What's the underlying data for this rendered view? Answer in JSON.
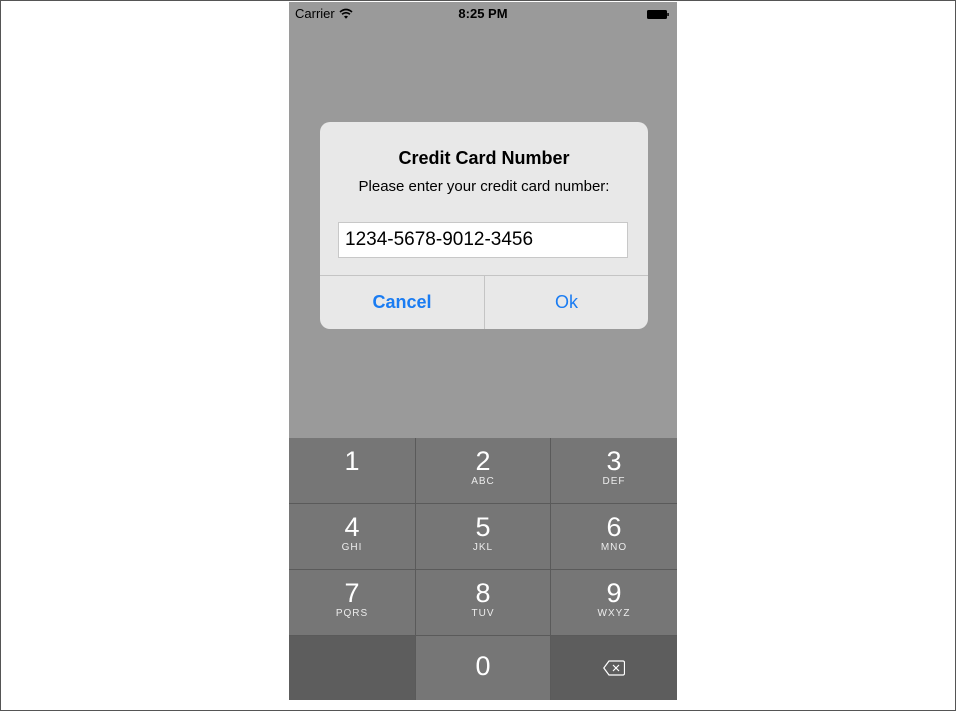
{
  "status_bar": {
    "carrier": "Carrier",
    "time": "8:25 PM",
    "wifi_icon": "wifi-icon",
    "battery_icon": "battery-icon"
  },
  "alert": {
    "title": "Credit Card Number",
    "message": "Please enter your credit card number:",
    "input_value": "1234-5678-9012-3456",
    "cancel_label": "Cancel",
    "ok_label": "Ok",
    "button_color": "#1a7cf2"
  },
  "keypad": {
    "keys": [
      {
        "digit": "1",
        "letters": ""
      },
      {
        "digit": "2",
        "letters": "ABC"
      },
      {
        "digit": "3",
        "letters": "DEF"
      },
      {
        "digit": "4",
        "letters": "GHI"
      },
      {
        "digit": "5",
        "letters": "JKL"
      },
      {
        "digit": "6",
        "letters": "MNO"
      },
      {
        "digit": "7",
        "letters": "PQRS"
      },
      {
        "digit": "8",
        "letters": "TUV"
      },
      {
        "digit": "9",
        "letters": "WXYZ"
      },
      {
        "digit": "0",
        "letters": ""
      }
    ],
    "backspace_icon": "backspace-icon"
  }
}
